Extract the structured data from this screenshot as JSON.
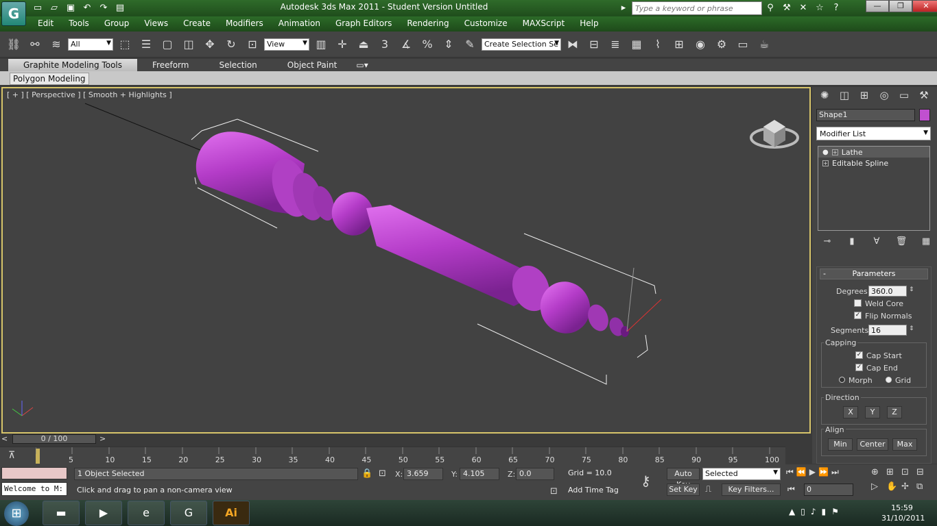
{
  "window": {
    "title": "Autodesk 3ds Max  2011  -  Student Version    Untitled",
    "search_placeholder": "Type a keyword or phrase"
  },
  "quick_access": [
    "new-icon",
    "open-icon",
    "save-icon",
    "undo-icon",
    "redo-icon",
    "project-icon"
  ],
  "menu": [
    "Edit",
    "Tools",
    "Group",
    "Views",
    "Create",
    "Modifiers",
    "Animation",
    "Graph Editors",
    "Rendering",
    "Customize",
    "MAXScript",
    "Help"
  ],
  "toolbar": {
    "selection_filter": "All",
    "ref_coord": "View",
    "named_selection_placeholder": "Create Selection Se"
  },
  "ribbon": {
    "tabs": [
      "Graphite Modeling Tools",
      "Freeform",
      "Selection",
      "Object Paint"
    ],
    "subtab": "Polygon Modeling"
  },
  "viewport": {
    "label": "[ + ] [ Perspective ] [ Smooth + Highlights ]",
    "object_color": "#b43cc8"
  },
  "command_panel": {
    "object_name": "Shape1",
    "object_color": "#c050d0",
    "modifier_list": "Modifier List",
    "stack": [
      "Lathe",
      "Editable Spline"
    ],
    "params": {
      "title": "Parameters",
      "degrees_label": "Degrees:",
      "degrees": "360.0",
      "weld_core": "Weld Core",
      "flip_normals": "Flip Normals",
      "segments_label": "Segments:",
      "segments": "16",
      "capping_title": "Capping",
      "cap_start": "Cap Start",
      "cap_end": "Cap End",
      "morph": "Morph",
      "grid": "Grid",
      "direction_title": "Direction",
      "dir": [
        "X",
        "Y",
        "Z"
      ],
      "align_title": "Align",
      "align": [
        "Min",
        "Center",
        "Max"
      ]
    }
  },
  "time": {
    "slider": "0 / 100",
    "ticks": [
      "5",
      "10",
      "15",
      "20",
      "25",
      "30",
      "35",
      "40",
      "45",
      "50",
      "55",
      "60",
      "65",
      "70",
      "75",
      "80",
      "85",
      "90",
      "95",
      "100"
    ]
  },
  "status": {
    "listener": "Welcome to M:",
    "selected": "1 Object Selected",
    "prompt": "Click and drag to pan a non-camera view",
    "x_label": "X:",
    "x": "3.659",
    "y_label": "Y:",
    "y": "4.105",
    "z_label": "Z:",
    "z": "0.0",
    "grid": "Grid = 10.0",
    "add_time_tag": "Add Time Tag",
    "auto_key": "Auto Key",
    "set_key": "Set Key",
    "key_mode": "Selected",
    "key_filters": "Key Filters...",
    "frame": "0"
  },
  "taskbar": {
    "time": "15:59",
    "date": "31/10/2011",
    "apps": [
      "windows-logo",
      "explorer-icon",
      "media-player-icon",
      "ie-icon",
      "3dsmax-icon",
      "illustrator-icon"
    ],
    "ai_label": "Ai"
  }
}
